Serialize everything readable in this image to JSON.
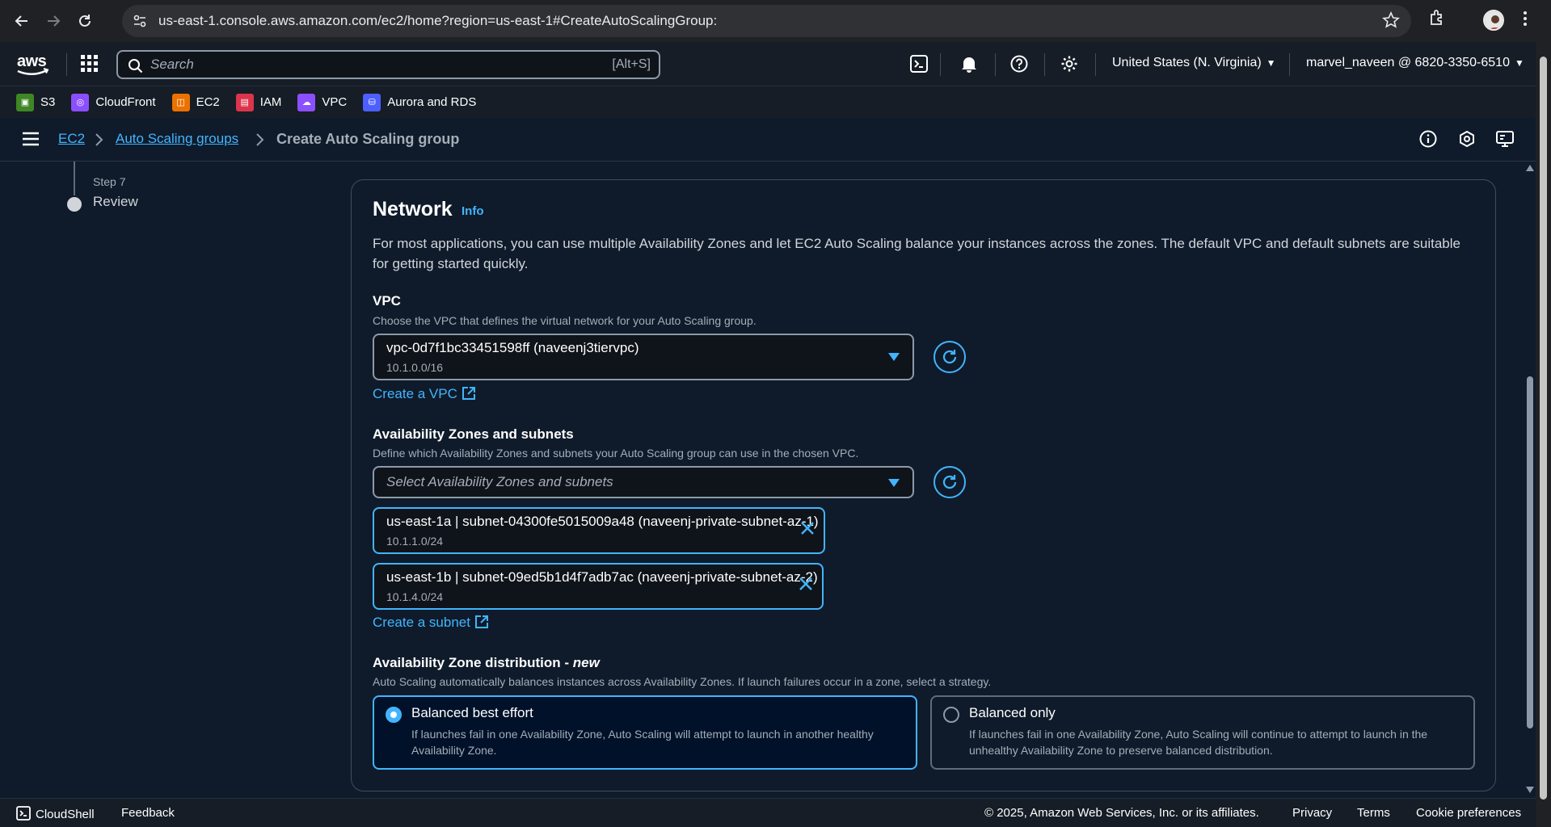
{
  "browser": {
    "url": "us-east-1.console.aws.amazon.com/ec2/home?region=us-east-1#CreateAutoScalingGroup:"
  },
  "header": {
    "search_placeholder": "Search",
    "search_shortcut": "[Alt+S]",
    "region": "United States (N. Virginia)",
    "account": "marvel_naveen @ 6820-3350-6510"
  },
  "favorites": [
    {
      "label": "S3",
      "color": "#3f8624"
    },
    {
      "label": "CloudFront",
      "color": "#8c4fff"
    },
    {
      "label": "EC2",
      "color": "#ed7100"
    },
    {
      "label": "IAM",
      "color": "#dd344c"
    },
    {
      "label": "VPC",
      "color": "#8c4fff"
    },
    {
      "label": "Aurora and RDS",
      "color": "#4d5fff"
    }
  ],
  "breadcrumb": {
    "item1": "EC2",
    "item2": "Auto Scaling groups",
    "current": "Create Auto Scaling group"
  },
  "steps": {
    "small": "Step 7",
    "label": "Review"
  },
  "network": {
    "title": "Network",
    "info": "Info",
    "description": "For most applications, you can use multiple Availability Zones and let EC2 Auto Scaling balance your instances across the zones. The default VPC and default subnets are suitable for getting started quickly.",
    "vpc": {
      "label": "VPC",
      "description": "Choose the VPC that defines the virtual network for your Auto Scaling group.",
      "selected": "vpc-0d7f1bc33451598ff (naveenj3tiervpc)",
      "cidr": "10.1.0.0/16",
      "create_link": "Create a VPC"
    },
    "az": {
      "label": "Availability Zones and subnets",
      "description": "Define which Availability Zones and subnets your Auto Scaling group can use in the chosen VPC.",
      "placeholder": "Select Availability Zones and subnets",
      "tokens": [
        {
          "main": "us-east-1a | subnet-04300fe5015009a48 (naveenj-private-subnet-az-1)",
          "sub": "10.1.1.0/24"
        },
        {
          "main": "us-east-1b | subnet-09ed5b1d4f7adb7ac (naveenj-private-subnet-az-2)",
          "sub": "10.1.4.0/24"
        }
      ],
      "create_link": "Create a subnet"
    },
    "distribution": {
      "label": "Availability Zone distribution - ",
      "label_new": "new",
      "description": "Auto Scaling automatically balances instances across Availability Zones. If launch failures occur in a zone, select a strategy.",
      "options": [
        {
          "title": "Balanced best effort",
          "desc": "If launches fail in one Availability Zone, Auto Scaling will attempt to launch in another healthy Availability Zone.",
          "selected": true
        },
        {
          "title": "Balanced only",
          "desc": "If launches fail in one Availability Zone, Auto Scaling will continue to attempt to launch in the unhealthy Availability Zone to preserve balanced distribution.",
          "selected": false
        }
      ]
    }
  },
  "footer": {
    "cloudshell": "CloudShell",
    "feedback": "Feedback",
    "copyright": "© 2025, Amazon Web Services, Inc. or its affiliates.",
    "privacy": "Privacy",
    "terms": "Terms",
    "cookies": "Cookie preferences"
  }
}
